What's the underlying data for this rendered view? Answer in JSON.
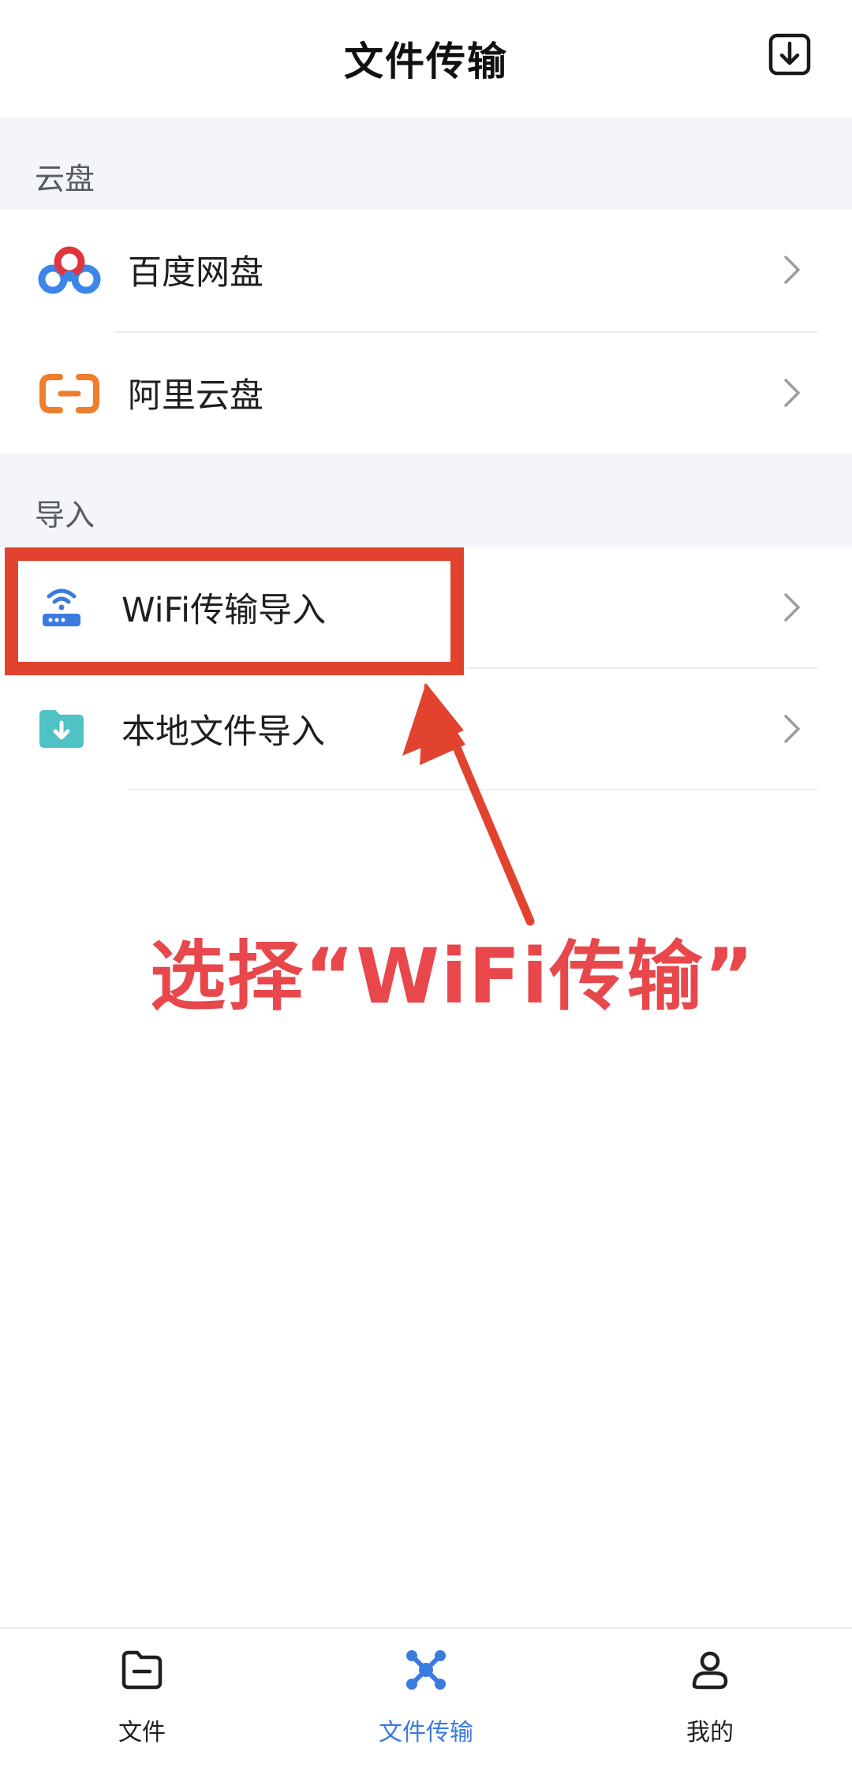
{
  "header": {
    "title": "文件传输",
    "download_icon": "download-box-icon"
  },
  "sections": [
    {
      "title": "云盘",
      "items": [
        {
          "label": "百度网盘",
          "icon": "baidu-netdisk-icon"
        },
        {
          "label": "阿里云盘",
          "icon": "aliyun-drive-icon"
        }
      ]
    },
    {
      "title": "导入",
      "items": [
        {
          "label": "WiFi传输导入",
          "icon": "wifi-router-icon"
        },
        {
          "label": "本地文件导入",
          "icon": "folder-download-icon"
        }
      ]
    }
  ],
  "annotation": {
    "text": "选择“WiFi传输”",
    "color": "#e8474b"
  },
  "tabbar": {
    "tabs": [
      {
        "label": "文件",
        "icon": "folder-icon",
        "active": false
      },
      {
        "label": "文件传输",
        "icon": "transfer-network-icon",
        "active": true
      },
      {
        "label": "我的",
        "icon": "profile-icon",
        "active": false
      }
    ],
    "active_color": "#3a7be0",
    "inactive_color": "#1d1f23"
  }
}
